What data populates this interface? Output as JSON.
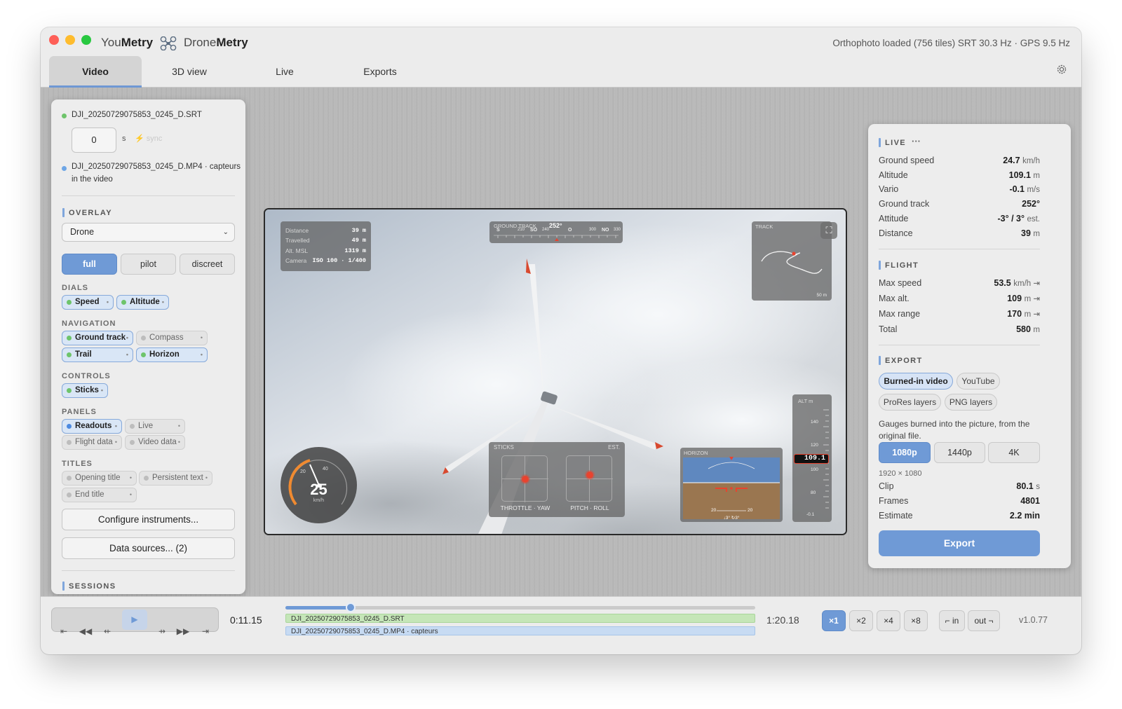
{
  "app": {
    "brand_you_plain": "You",
    "brand_you_bold": "Metry",
    "brand_drone_plain": "Drone",
    "brand_drone_bold": "Metry",
    "status": "Orthophoto loaded (756 tiles)   SRT 30.3 Hz · GPS 9.5 Hz"
  },
  "tabs": [
    {
      "label": "Video",
      "active": true
    },
    {
      "label": "3D view",
      "active": false
    },
    {
      "label": "Live",
      "active": false
    },
    {
      "label": "Exports",
      "active": false
    }
  ],
  "left": {
    "srt_file": "DJI_20250729075853_0245_D.SRT",
    "offset_value": "0",
    "offset_unit": "s",
    "sync_label": "sync",
    "mp4_file": "DJI_20250729075853_0245_D.MP4 · capteurs",
    "mp4_note": "in the video",
    "overlay_title": "OVERLAY",
    "overlay_select": "Drone",
    "modes": [
      "full",
      "pilot",
      "discreet"
    ],
    "groups": {
      "dials": "DIALS",
      "navigation": "NAVIGATION",
      "controls": "CONTROLS",
      "panels": "PANELS",
      "titles": "TITLES"
    },
    "chips": {
      "speed": "Speed",
      "altitude": "Altitude",
      "ground_track": "Ground track",
      "compass": "Compass",
      "trail": "Trail",
      "horizon": "Horizon",
      "sticks": "Sticks",
      "readouts": "Readouts",
      "live": "Live",
      "flight_data": "Flight data",
      "video_data": "Video data",
      "opening_title": "Opening title",
      "persistent_text": "Persistent text",
      "end_title": "End title"
    },
    "configure_button": "Configure instruments...",
    "sources_button": "Data sources... (2)",
    "sessions_title": "SESSIONS"
  },
  "video": {
    "readouts": [
      {
        "k": "Distance",
        "v": "39 m"
      },
      {
        "k": "Travelled",
        "v": "49 m"
      },
      {
        "k": "Alt. MSL",
        "v": "1319 m"
      },
      {
        "k": "Camera",
        "v": "ISO 100 · 1/400"
      }
    ],
    "ground_track_label": "GROUND TRACK",
    "ground_track_value": "252°",
    "compass_ticks": [
      "S",
      "210",
      "SO",
      "240",
      "O",
      "300",
      "NO",
      "330"
    ],
    "track_label": "TRACK",
    "track_scale": "50 m",
    "speed_value": "25",
    "speed_unit": "km/h",
    "speed_ticks": [
      "20",
      "40"
    ],
    "sticks_label": "STICKS",
    "sticks_est": "EST.",
    "stick_left": "THROTTLE · YAW",
    "stick_right": "PITCH · ROLL",
    "horizon_label": "HORIZON",
    "horizon_ticks": [
      "20",
      "20"
    ],
    "horizon_readout": "↓3° ↻3°",
    "alt_label": "ALT m",
    "alt_ticks": [
      "140",
      "120",
      "100",
      "80"
    ],
    "alt_value": "109.1",
    "alt_bottom": "-0.1"
  },
  "right": {
    "live_title": "LIVE",
    "live_more": "···",
    "live": [
      {
        "k": "Ground speed",
        "v": "24.7",
        "u": "km/h"
      },
      {
        "k": "Altitude",
        "v": "109.1",
        "u": "m"
      },
      {
        "k": "Vario",
        "v": "-0.1",
        "u": "m/s"
      },
      {
        "k": "Ground track",
        "v": "252°",
        "u": ""
      },
      {
        "k": "Attitude",
        "v": "-3° / 3°",
        "u": "est."
      },
      {
        "k": "Distance",
        "v": "39",
        "u": "m"
      }
    ],
    "flight_title": "FLIGHT",
    "flight": [
      {
        "k": "Max speed",
        "v": "53.5",
        "u": "km/h ⇥"
      },
      {
        "k": "Max alt.",
        "v": "109",
        "u": "m ⇥"
      },
      {
        "k": "Max range",
        "v": "170",
        "u": "m ⇥"
      },
      {
        "k": "Total",
        "v": "580",
        "u": "m"
      }
    ],
    "export_title": "EXPORT",
    "export_types": [
      "Burned-in video",
      "YouTube",
      "ProRes layers",
      "PNG layers"
    ],
    "export_desc": "Gauges burned into the picture, from the original file.",
    "resolutions": [
      "1080p",
      "1440p",
      "4K"
    ],
    "res_dims": "1920 × 1080",
    "clip_stats": [
      {
        "k": "Clip",
        "v": "80.1",
        "u": "s"
      },
      {
        "k": "Frames",
        "v": "4801",
        "u": ""
      },
      {
        "k": "Estimate",
        "v": "2.2 min",
        "u": ""
      }
    ],
    "export_button": "Export"
  },
  "timeline": {
    "current_time": "0:11.15",
    "total_time": "1:20.18",
    "progress": 0.139,
    "track_srt": "DJI_20250729075853_0245_D.SRT",
    "track_mp4": "DJI_20250729075853_0245_D.MP4 · capteurs",
    "speeds": [
      "×1",
      "×2",
      "×4",
      "×8"
    ],
    "in_label": "⌐ in",
    "out_label": "out ¬",
    "version": "v1.0.77"
  },
  "colors": {
    "accent": "#6f9ad6",
    "srt_track": "#c5e6b8",
    "mp4_track": "#c7dbf3",
    "marker": "#e8432f"
  }
}
